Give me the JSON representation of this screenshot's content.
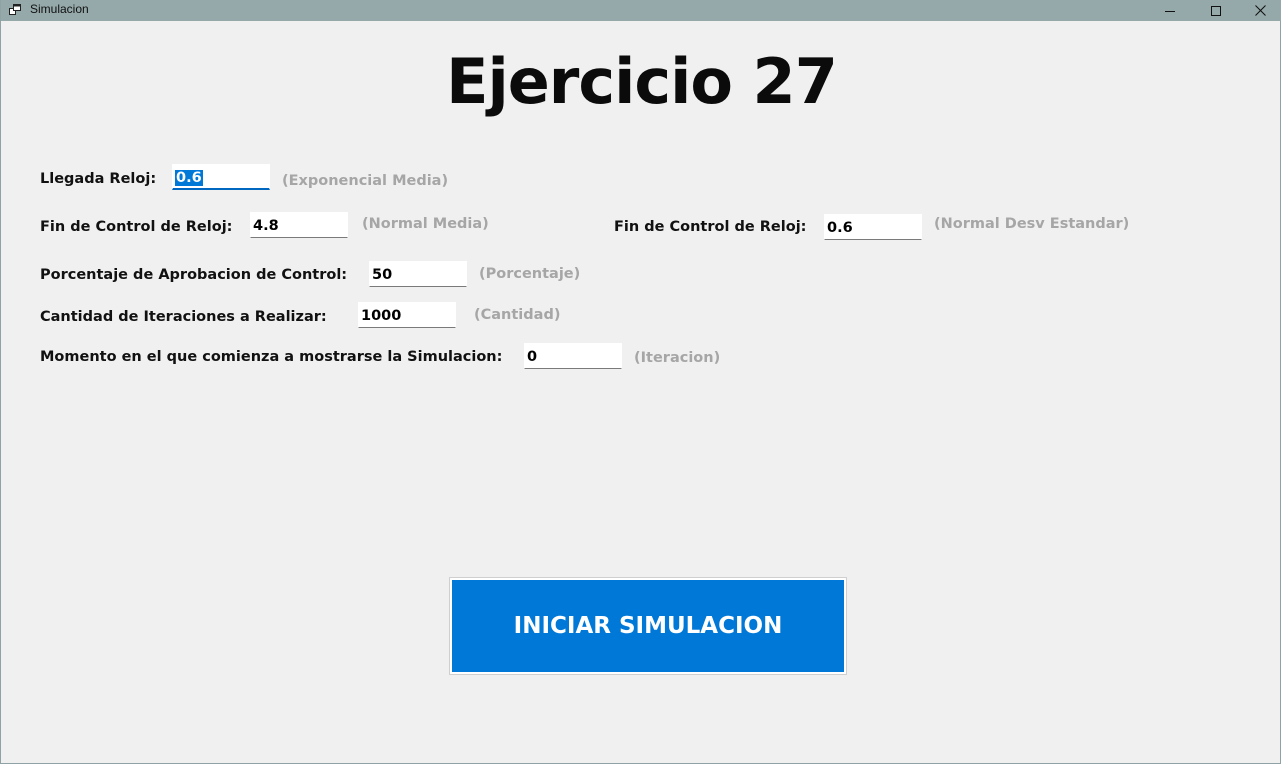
{
  "window": {
    "title": "Simulacion",
    "icon": "app-window-icon",
    "controls": {
      "minimize_icon": "minimize-icon",
      "maximize_icon": "maximize-icon",
      "close_icon": "close-icon"
    }
  },
  "heading": "Ejercicio 27",
  "form": {
    "llegada_reloj": {
      "label": "Llegada Reloj:",
      "value": "0.6",
      "hint": "(Exponencial Media)"
    },
    "fin_control_media": {
      "label": "Fin de Control de Reloj:",
      "value": "4.8",
      "hint": "(Normal Media)"
    },
    "fin_control_desv": {
      "label": "Fin de Control de Reloj:",
      "value": "0.6",
      "hint": "(Normal Desv Estandar)"
    },
    "porcentaje_aprobacion": {
      "label": "Porcentaje de Aprobacion de Control:",
      "value": "50",
      "hint": "(Porcentaje)"
    },
    "cantidad_iteraciones": {
      "label": "Cantidad de Iteraciones a Realizar:",
      "value": "1000",
      "hint": "(Cantidad)"
    },
    "momento_inicio": {
      "label": "Momento en el que comienza a mostrarse la Simulacion:",
      "value": "0",
      "hint": "(Iteracion)"
    }
  },
  "actions": {
    "start_label": "INICIAR SIMULACION"
  },
  "colors": {
    "titlebar": "#95a9aa",
    "background": "#f0f0f0",
    "accent": "#0078d7",
    "hint_text": "#a6a6a6"
  }
}
